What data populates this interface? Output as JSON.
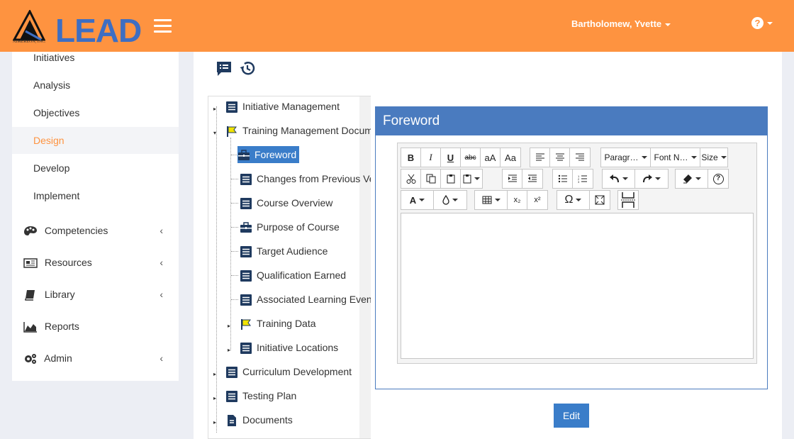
{
  "header": {
    "logo_text": "LEAD",
    "logo_subtitle": "AIMEREON, INC.",
    "user_name": "Bartholomew, Yvette",
    "help_label": "?",
    "brand_color": "#fe9340",
    "logo_color": "#3e6ec2"
  },
  "sidebar": {
    "sub_items": [
      {
        "label": "Initiatives"
      },
      {
        "label": "Analysis"
      },
      {
        "label": "Objectives"
      },
      {
        "label": "Design",
        "active": true
      },
      {
        "label": "Develop"
      },
      {
        "label": "Implement"
      }
    ],
    "main_items": [
      {
        "label": "Competencies",
        "icon": "palette-icon",
        "chevron": "‹"
      },
      {
        "label": "Resources",
        "icon": "newspaper-icon",
        "chevron": "‹"
      },
      {
        "label": "Library",
        "icon": "book-icon",
        "chevron": "‹"
      },
      {
        "label": "Reports",
        "icon": "area-chart-icon",
        "chevron": ""
      },
      {
        "label": "Admin",
        "icon": "cogs-icon",
        "chevron": "‹"
      }
    ]
  },
  "toolbar_icons": [
    "comment-list-icon",
    "history-icon"
  ],
  "tree": {
    "nodes": [
      {
        "label": "Initiative Management",
        "icon": "document-list-icon"
      },
      {
        "label": "Training Management Document",
        "icon": "flag-icon"
      },
      {
        "label": "Foreword",
        "icon": "briefcase-icon",
        "selected": true
      },
      {
        "label": "Changes from Previous Version",
        "icon": "document-list-icon"
      },
      {
        "label": "Course Overview",
        "icon": "document-list-icon"
      },
      {
        "label": "Purpose of Course",
        "icon": "briefcase-icon"
      },
      {
        "label": "Target Audience",
        "icon": "document-list-icon"
      },
      {
        "label": "Qualification Earned",
        "icon": "document-list-icon"
      },
      {
        "label": "Associated Learning Events",
        "icon": "document-list-icon"
      },
      {
        "label": "Training Data",
        "icon": "flag-icon"
      },
      {
        "label": "Initiative Locations",
        "icon": "document-list-icon"
      },
      {
        "label": "Curriculum Development",
        "icon": "document-list-icon"
      },
      {
        "label": "Testing Plan",
        "icon": "document-list-icon"
      },
      {
        "label": "Documents",
        "icon": "file-icon"
      }
    ]
  },
  "panel": {
    "title": "Foreword",
    "header_color": "#4a7bbf"
  },
  "editor": {
    "format_dropdowns": {
      "paragraph": "Paragr…",
      "font": "Font N…",
      "size": "Size"
    },
    "buttons": {
      "bold": "B",
      "italic": "I",
      "underline": "U",
      "strike": "abc",
      "upper": "aA",
      "capitalize": "Aa",
      "text_color": "A",
      "subscript": "x₂",
      "superscript": "x²",
      "special_char": "Ω",
      "help": "?"
    }
  },
  "actions": {
    "edit_label": "Edit"
  }
}
